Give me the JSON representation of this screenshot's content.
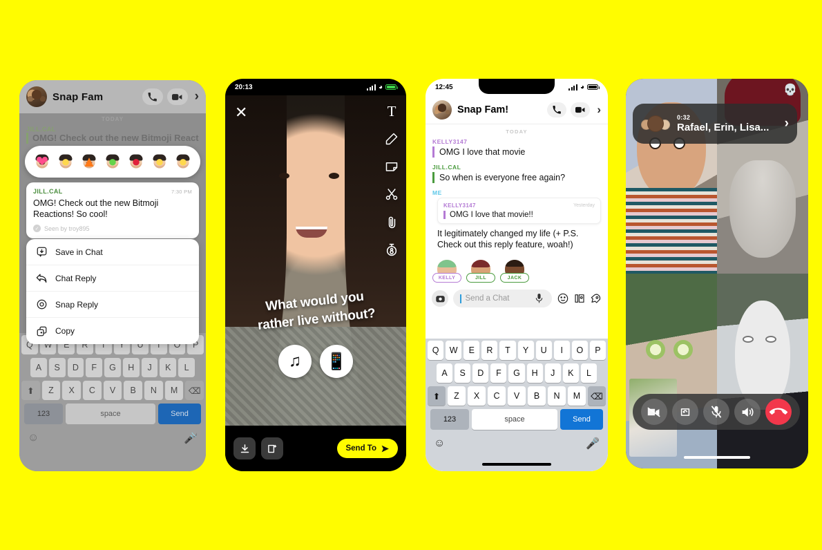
{
  "background_color": "#FFFC00",
  "phone1": {
    "header": {
      "title": "Snap Fam",
      "call_icon": "phone-icon",
      "video_icon": "video-camera-icon",
      "chevron": "›"
    },
    "day_divider": "TODAY",
    "ghost_message": {
      "sender": "JILL.CAL",
      "text": "OMG! Check out the new Bitmoji Reactions!"
    },
    "reactions": [
      {
        "name": "heart-reaction",
        "glyph": "💗",
        "color": "#ff4d8d"
      },
      {
        "name": "laugh-reaction",
        "glyph": "●",
        "color": "#ffd84d"
      },
      {
        "name": "fire-reaction",
        "glyph": "🔥",
        "color": "#ff7a18"
      },
      {
        "name": "thumbs-up-reaction",
        "glyph": "👍",
        "color": "#64d44a"
      },
      {
        "name": "rose-reaction",
        "glyph": "🌹",
        "color": "#e0213b"
      },
      {
        "name": "cry-reaction",
        "glyph": "●",
        "color": "#ffd84d"
      },
      {
        "name": "shock-reaction",
        "glyph": "●",
        "color": "#ffd84d"
      }
    ],
    "message_card": {
      "sender": "JILL.CAL",
      "time": "7:30 PM",
      "time_icon": "moon-icon",
      "text": "OMG! Check out the new Bitmoji Reactions! So cool!",
      "seen_icon": "check-circle-icon",
      "seen_text": "Seen by troy895"
    },
    "context_menu": [
      {
        "icon": "save-icon",
        "label": "Save in Chat"
      },
      {
        "icon": "reply-arrow-icon",
        "label": "Chat Reply"
      },
      {
        "icon": "snap-camera-icon",
        "label": "Snap Reply"
      },
      {
        "icon": "copy-icon",
        "label": "Copy"
      }
    ],
    "keyboard": {
      "row1": [
        "Q",
        "W",
        "E",
        "R",
        "T",
        "Y",
        "U",
        "I",
        "O",
        "P"
      ],
      "row2": [
        "A",
        "S",
        "D",
        "F",
        "G",
        "H",
        "J",
        "K",
        "L"
      ],
      "row3": [
        "Z",
        "X",
        "C",
        "V",
        "B",
        "N",
        "M"
      ],
      "shift_icon": "shift-icon",
      "backspace_icon": "backspace-icon",
      "numbers_key": "123",
      "space_key": "space",
      "send_key": "Send",
      "emoji_icon": "emoji-icon",
      "mic_icon": "microphone-icon"
    }
  },
  "phone2": {
    "status_bar": {
      "time": "20:13",
      "signal_icon": "cellular-bars-icon",
      "wifi_icon": "wifi-icon",
      "battery_icon": "battery-icon"
    },
    "close_icon": "close-x-icon",
    "tools": [
      {
        "name": "text-tool-icon",
        "glyph": "T"
      },
      {
        "name": "draw-pencil-icon",
        "glyph": "✎"
      },
      {
        "name": "sticker-tool-icon",
        "glyph": "▢"
      },
      {
        "name": "scissors-tool-icon",
        "glyph": "✂"
      },
      {
        "name": "paperclip-tool-icon",
        "glyph": "📎"
      },
      {
        "name": "timer-tool-icon",
        "glyph": "⧖"
      }
    ],
    "caption_line1": "What would you",
    "caption_line2": "rather live without?",
    "choices": [
      {
        "name": "music-choice",
        "glyph": "♫"
      },
      {
        "name": "phone-choice",
        "glyph": "📱"
      }
    ],
    "bottom": {
      "save_icon": "download-icon",
      "story_icon": "add-to-story-icon",
      "send_to_label": "Send To",
      "send_to_icon": "send-arrow-icon"
    }
  },
  "phone3": {
    "status_bar": {
      "time": "12:45",
      "signal_icon": "cellular-bars-icon",
      "wifi_icon": "wifi-icon",
      "battery_icon": "battery-icon"
    },
    "header": {
      "title": "Snap Fam!",
      "call_icon": "phone-icon",
      "video_icon": "video-camera-icon",
      "chevron": "›"
    },
    "day_divider": "TODAY",
    "messages": [
      {
        "sender": "KELLY3147",
        "color": "purple",
        "text": "OMG I love that movie"
      },
      {
        "sender": "JILL.CAL",
        "color": "green",
        "text": "So when is everyone free again?"
      }
    ],
    "reply_message": {
      "sender": "ME",
      "color": "blue",
      "quote": {
        "sender": "KELLY3147",
        "time": "Yesterday",
        "text": "OMG I love that movie!!"
      },
      "text": "It legitimately changed my life (+ P.S. Check out this reply feature, woah!)"
    },
    "presence": [
      {
        "name": "KELLY",
        "color": "#b47ad4",
        "hair": "#7fc48c",
        "skin": "#e8bc97"
      },
      {
        "name": "JILL",
        "color": "#4a9b3e",
        "hair": "#7a2b2b",
        "skin": "#d9a277"
      },
      {
        "name": "JACK",
        "color": "#4a9b3e",
        "hair": "#2b1c13",
        "skin": "#7a4a2e"
      }
    ],
    "input_bar": {
      "camera_icon": "camera-icon",
      "placeholder": "Send a Chat",
      "mic_icon": "microphone-icon",
      "emoji_icon": "emoji-smiley-icon",
      "bitmoji_icon": "bitmoji-icon",
      "rocket_icon": "rocket-icon"
    },
    "keyboard": {
      "row1": [
        "Q",
        "W",
        "E",
        "R",
        "T",
        "Y",
        "U",
        "I",
        "O",
        "P"
      ],
      "row2": [
        "A",
        "S",
        "D",
        "F",
        "G",
        "H",
        "J",
        "K",
        "L"
      ],
      "row3": [
        "Z",
        "X",
        "C",
        "V",
        "B",
        "N",
        "M"
      ],
      "shift_icon": "shift-icon",
      "backspace_icon": "backspace-icon",
      "numbers_key": "123",
      "space_key": "space",
      "send_key": "Send",
      "emoji_icon": "emoji-icon",
      "mic_icon": "microphone-icon"
    }
  },
  "phone4": {
    "skull_icon": "skull-lens-icon",
    "call_header": {
      "duration": "0:32",
      "participants": "Rafael, Erin, Lisa...",
      "chevron": "›"
    },
    "controls": [
      {
        "name": "camera-off-button",
        "icon": "video-off-icon"
      },
      {
        "name": "flip-camera-button",
        "icon": "flip-camera-icon"
      },
      {
        "name": "mute-button",
        "icon": "microphone-muted-icon"
      },
      {
        "name": "speaker-button",
        "icon": "speaker-icon"
      },
      {
        "name": "end-call-button",
        "icon": "end-call-icon"
      }
    ]
  }
}
